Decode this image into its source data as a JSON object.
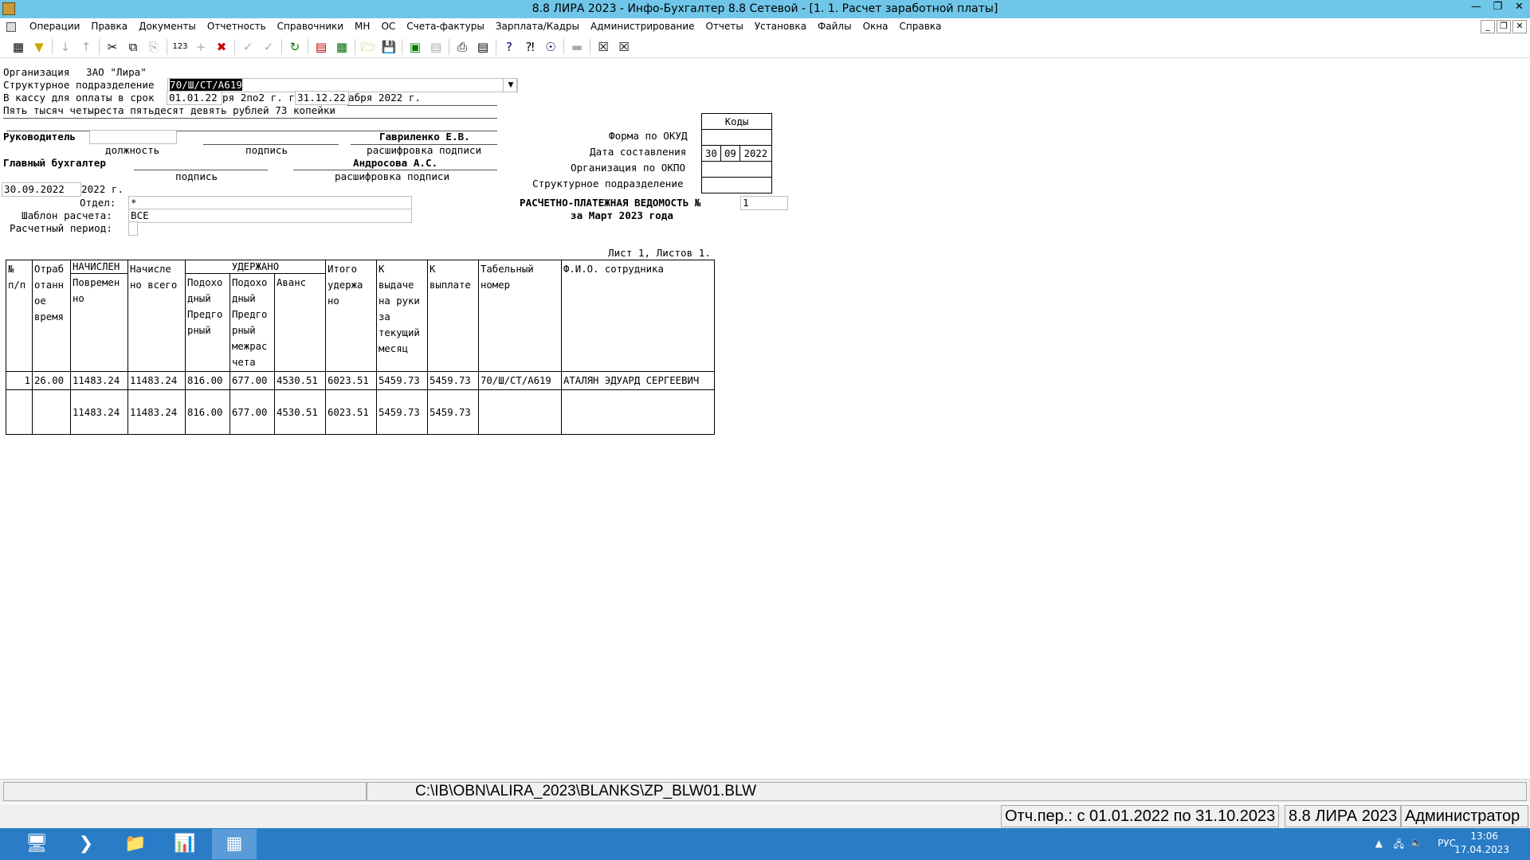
{
  "window": {
    "title": "8.8 ЛИРА 2023 - Инфо-Бухгалтер 8.8 Сетевой - [1. 1. Расчет заработной платы]"
  },
  "menu": [
    "Операции",
    "Правка",
    "Документы",
    "Отчетность",
    "Справочники",
    "МН",
    "ОС",
    "Счета-фактуры",
    "Зарплата/Кадры",
    "Администрирование",
    "Отчеты",
    "Установка",
    "Файлы",
    "Окна",
    "Справка"
  ],
  "header": {
    "org_label": "Организация",
    "org_value": "ЗАО \"Лира\"",
    "dept_label": "Структурное подразделение",
    "dept_value": "70/Ш/СТ/А619",
    "kassa_label": "В кассу для оплаты в срок",
    "date_from": "01.01.22",
    "date_from_tail": "ря 2по2 г. г",
    "date_to": "31.12.22",
    "date_to_tail": "абря 2022 г.",
    "amount_words": "Пять тысяч четыреста пятьдесят девять рублей 73 копейки",
    "head_label": "Руководитель",
    "head_name": "Гавриленко Е.В.",
    "position_cap": "должность",
    "signature_cap": "подпись",
    "decode_cap": "расшифровка подписи",
    "chief_label": "Главный бухгалтер",
    "chief_name": "Андросова А.С.",
    "chief_signature_cap": "подпись",
    "chief_decode_cap": "расшифровка подписи",
    "date_value": "30.09.2022",
    "date_tail": "2022 г.",
    "otdel_label": "Отдел:",
    "otdel_value": "*",
    "template_label": "Шаблон расчета:",
    "template_value": "ВСЕ",
    "period_label": "Расчетный период:"
  },
  "codes": {
    "title": "Коды",
    "okud_label": "Форма по ОКУД",
    "date_label": "Дата составления",
    "day": "30",
    "month": "09",
    "year": "2022",
    "okpo_label": "Организация по ОКПО",
    "dept_label": "Структурное подразделение"
  },
  "statement": {
    "title": "РАСЧЕТНО-ПЛАТЕЖНАЯ ВЕДОМОСТЬ №",
    "number": "1",
    "period": "за Март 2023 года",
    "sheet": "Лист 1, Листов 1."
  },
  "table": {
    "h_no": "№\nп/п",
    "h_time": "Отраб\nотанн\nое\nвремя",
    "h_accr_group": "НАЧИСЛЕН",
    "h_accr": "Повремен\nно",
    "h_accr_total": "Начисле\nно всего",
    "h_ded_group": "УДЕРЖАНО",
    "h_tax1": "Подохо\nдный\nПредго\nрный",
    "h_tax2": "Подохо\nдный\nПредго\nрный\nмежрас\nчета",
    "h_adv": "Аванс",
    "h_ded_total": "Итого\nудержа\nно",
    "h_cash": "К\nвыдаче\nна руки\nза\nтекущий\nмесяц",
    "h_pay": "К\nвыплате",
    "h_tab": "Табельный\nномер",
    "h_fio": "Ф.И.О. сотрудника",
    "rows": [
      {
        "no": "1",
        "time": "26.00",
        "accr": "11483.24",
        "accr_total": "11483.24",
        "tax1": "816.00",
        "tax2": "677.00",
        "adv": "4530.51",
        "ded_total": "6023.51",
        "cash": "5459.73",
        "pay": "5459.73",
        "tab": "70/Ш/СТ/А619",
        "fio": "АТАЛЯН ЭДУАРД СЕРГЕЕВИЧ"
      }
    ],
    "totals": {
      "accr": "11483.24",
      "accr_total": "11483.24",
      "tax1": "816.00",
      "tax2": "677.00",
      "adv": "4530.51",
      "ded_total": "6023.51",
      "cash": "5459.73",
      "pay": "5459.73"
    }
  },
  "status": {
    "path": "C:\\IB\\OBN\\ALIRA_2023\\BLANKS\\ZP_BLW01.BLW",
    "period": "Отч.пер.: с 01.01.2022 по 31.10.2023",
    "product": "8.8 ЛИРА 2023",
    "user": "Администратор"
  },
  "taskbar": {
    "lang": "РУС",
    "time": "13:06",
    "date": "17.04.2023"
  }
}
